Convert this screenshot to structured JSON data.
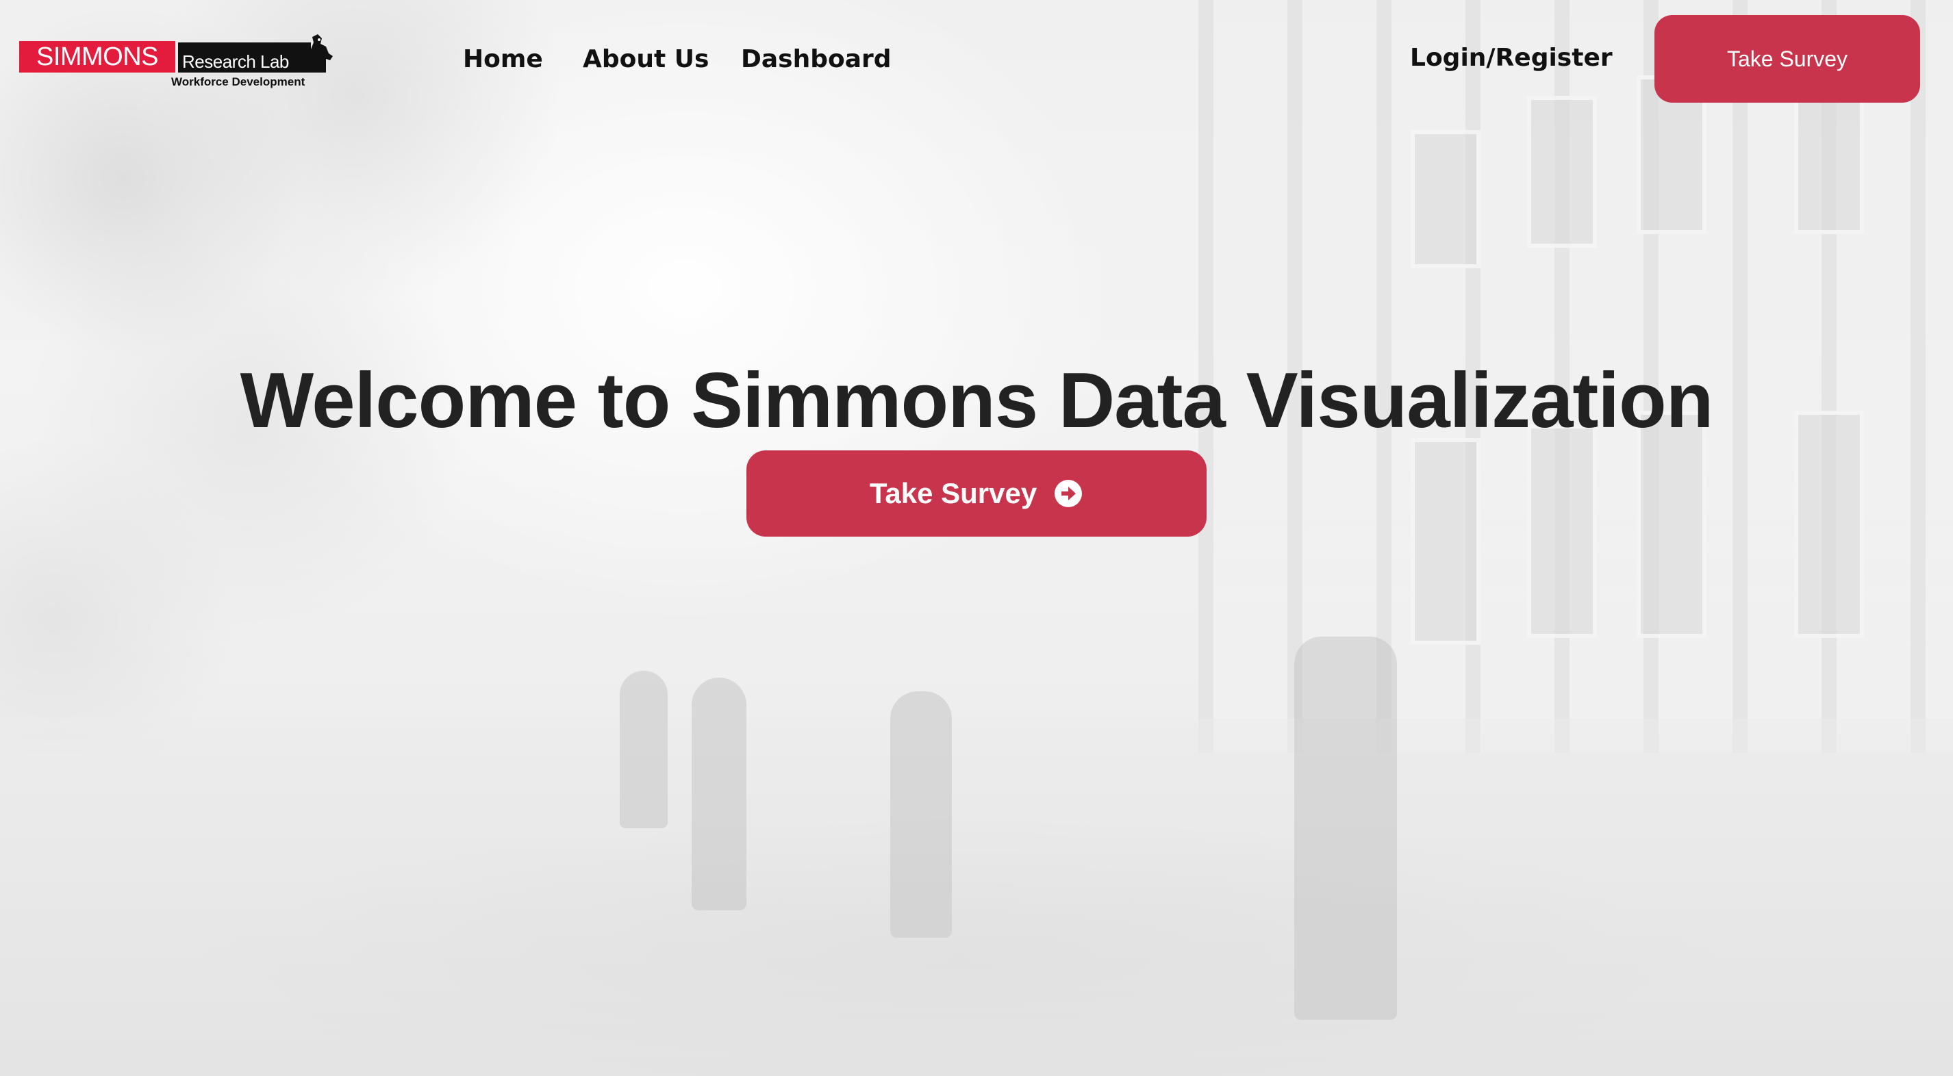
{
  "logo": {
    "brand": "SIMMONS",
    "lab": "Research Lab",
    "tagline": "Workforce Development",
    "mascot_icon": "bull-mascot-icon"
  },
  "nav": {
    "links": [
      "Home",
      "About Us",
      "Dashboard"
    ],
    "login": "Login/Register",
    "survey_button": "Take Survey"
  },
  "hero": {
    "title": "Welcome to Simmons Data Visualization",
    "survey_button": "Take Survey",
    "survey_icon": "circle-arrow-right-icon"
  },
  "colors": {
    "accent": "#c8344b",
    "logo_red": "#e31b3c",
    "text": "#222222"
  }
}
